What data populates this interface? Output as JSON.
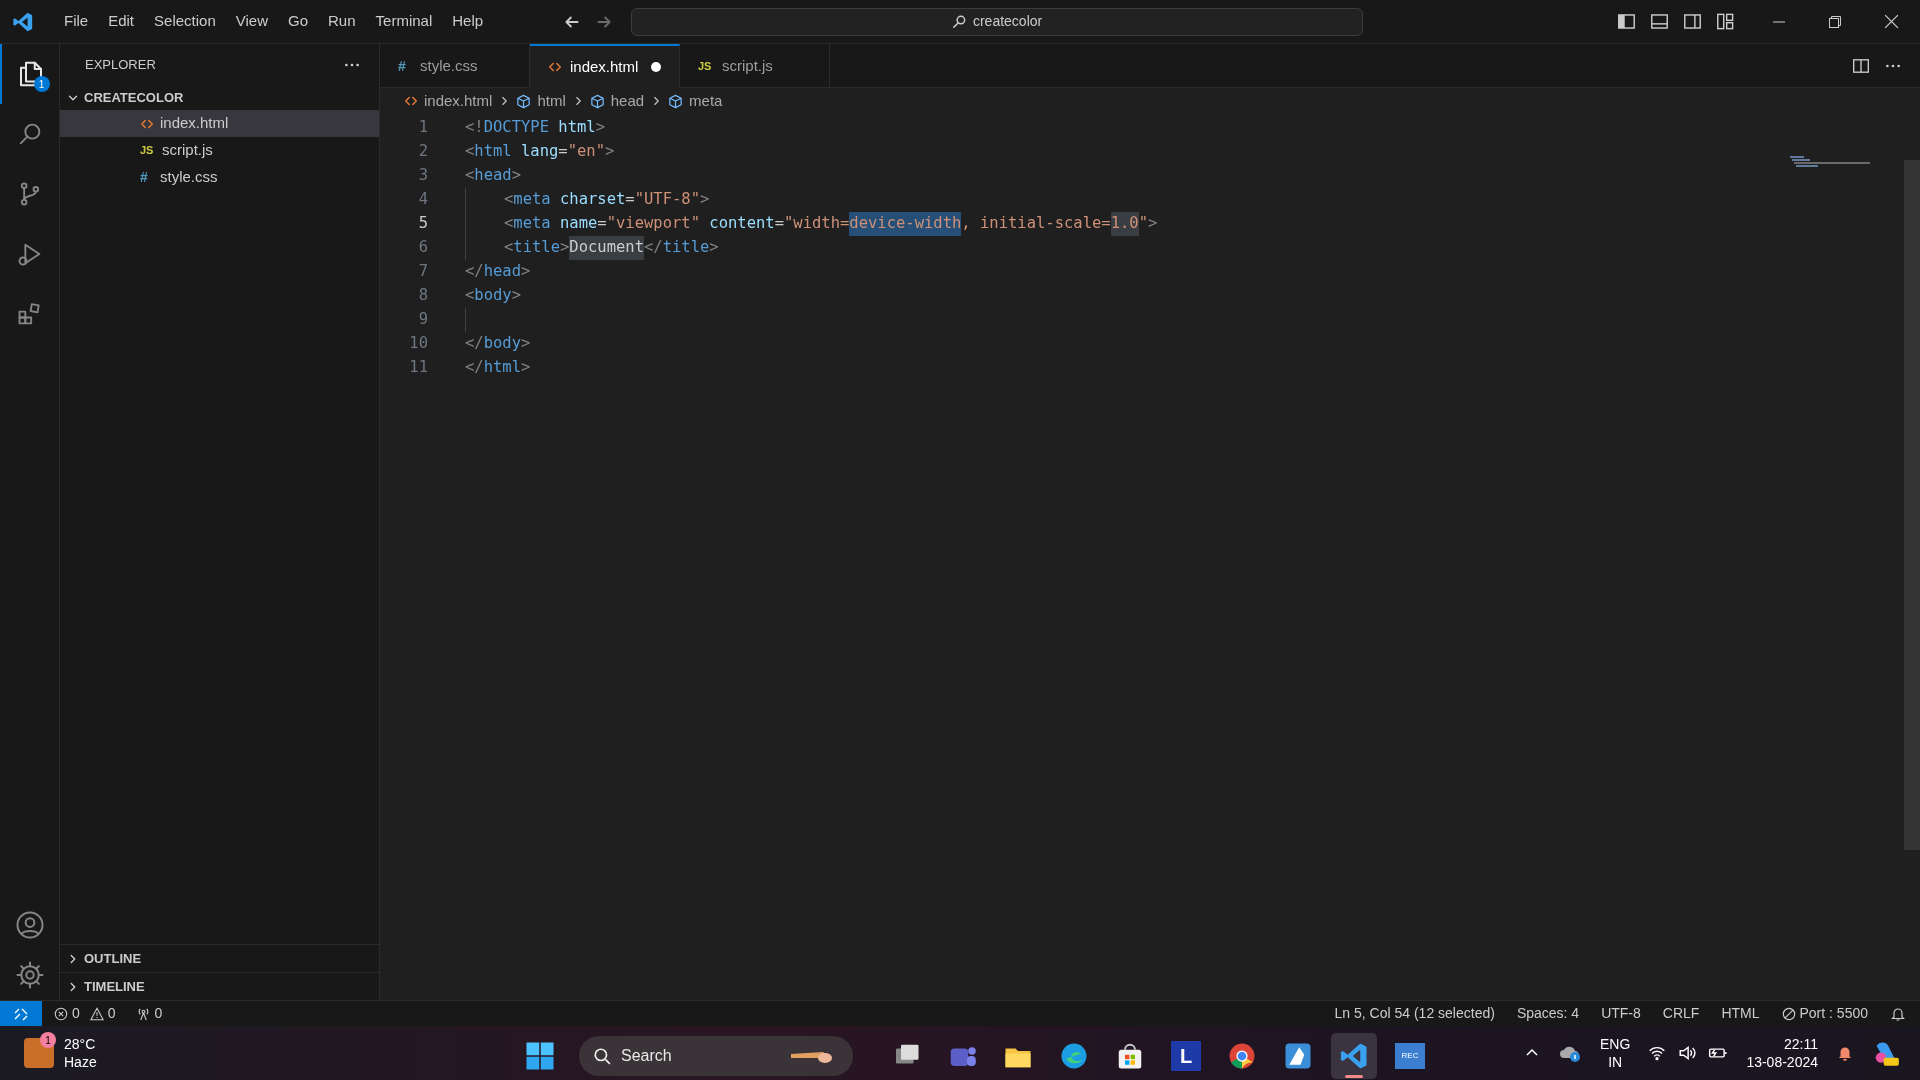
{
  "menu": [
    "File",
    "Edit",
    "Selection",
    "View",
    "Go",
    "Run",
    "Terminal",
    "Help"
  ],
  "command_center": {
    "value": "createcolor"
  },
  "activity_bar": {
    "items": [
      {
        "kind": "explorer",
        "selected": true,
        "badge": "1"
      },
      {
        "kind": "search",
        "selected": false
      },
      {
        "kind": "source-control",
        "selected": false
      },
      {
        "kind": "run",
        "selected": false
      },
      {
        "kind": "extensions",
        "selected": false
      }
    ],
    "bottom": [
      {
        "kind": "account"
      },
      {
        "kind": "settings"
      }
    ]
  },
  "sidebar": {
    "title": "EXPLORER",
    "folder": {
      "label": "CREATECOLOR",
      "expanded": true,
      "children": [
        {
          "label": "index.html",
          "kind": "html",
          "selected": true
        },
        {
          "label": "script.js",
          "kind": "js",
          "glyph": "JS",
          "selected": false
        },
        {
          "label": "style.css",
          "kind": "css",
          "glyph": "#",
          "selected": false
        }
      ]
    },
    "sections": [
      {
        "label": "OUTLINE",
        "expanded": false
      },
      {
        "label": "TIMELINE",
        "expanded": false
      }
    ]
  },
  "tabs": [
    {
      "label": "style.css",
      "kind": "css",
      "glyph": "#",
      "selected": false,
      "modified": false
    },
    {
      "label": "index.html",
      "kind": "html",
      "selected": true,
      "modified": true
    },
    {
      "label": "script.js",
      "kind": "js",
      "glyph": "JS",
      "selected": false,
      "modified": false
    }
  ],
  "breadcrumbs": [
    {
      "label": "index.html",
      "kind": "html"
    },
    {
      "label": "html",
      "kind": "symbol"
    },
    {
      "label": "head",
      "kind": "symbol"
    },
    {
      "label": "meta",
      "kind": "symbol"
    }
  ],
  "editor": {
    "lines": [
      {
        "number": "1",
        "active": false,
        "indented": false,
        "segments": [
          {
            "text": "<!DOCTYPE html>",
            "kind": "plain"
          }
        ]
      },
      {
        "number": "2",
        "active": false,
        "indented": false,
        "segments": [
          {
            "text": "<html lang=\"en\">",
            "kind": "plain"
          }
        ]
      },
      {
        "number": "3",
        "active": false,
        "indented": false,
        "segments": [
          {
            "text": "<head>",
            "kind": "plain"
          }
        ]
      },
      {
        "number": "4",
        "active": false,
        "indented": true,
        "segments": [
          {
            "text": "<meta charset=\"UTF-8\">",
            "kind": "plain"
          }
        ]
      },
      {
        "number": "5",
        "active": true,
        "indented": true,
        "segments": [
          {
            "text": "<meta name=\"viewport\" content=\"width=",
            "kind": "plain"
          },
          {
            "text": "device-width",
            "kind": "selection"
          },
          {
            "text": ", initial-scale=",
            "kind": "plain"
          },
          {
            "text": "1.0",
            "kind": "match"
          },
          {
            "text": "\">",
            "kind": "plain"
          }
        ]
      },
      {
        "number": "6",
        "active": false,
        "indented": true,
        "segments": [
          {
            "text": "<title>",
            "kind": "plain"
          },
          {
            "text": "Document",
            "kind": "match"
          },
          {
            "text": "</title>",
            "kind": "plain"
          }
        ]
      },
      {
        "number": "7",
        "active": false,
        "indented": false,
        "segments": [
          {
            "text": "</head>",
            "kind": "plain"
          }
        ]
      },
      {
        "number": "8",
        "active": false,
        "indented": false,
        "segments": [
          {
            "text": "<body>",
            "kind": "plain"
          }
        ]
      },
      {
        "number": "9",
        "active": false,
        "indented": true
      },
      {
        "number": "10",
        "active": false,
        "indented": false,
        "segments": [
          {
            "text": "</body>",
            "kind": "plain"
          }
        ]
      },
      {
        "number": "11",
        "active": false,
        "indented": false,
        "segments": [
          {
            "text": "</html>",
            "kind": "plain"
          }
        ]
      }
    ]
  },
  "status_bar": {
    "errors": "0",
    "warnings": "0",
    "ports": "0",
    "items": [
      "Ln 5, Col 54 (12 selected)",
      "Spaces: 4",
      "UTF-8",
      "CRLF",
      "HTML"
    ],
    "port": "Port : 5500"
  },
  "taskbar": {
    "weather": {
      "badge": "1",
      "temperature": "28°C",
      "condition": "Haze"
    },
    "search": {
      "placeholder": "Search"
    },
    "apps": [
      {
        "kind": "task-view",
        "active": false
      },
      {
        "kind": "teams",
        "active": false
      },
      {
        "kind": "folder",
        "active": false
      },
      {
        "kind": "edge",
        "active": false
      },
      {
        "kind": "store",
        "active": false
      },
      {
        "kind": "letter",
        "label": "L",
        "active": false
      },
      {
        "kind": "chrome",
        "active": false
      },
      {
        "kind": "paint",
        "active": false
      },
      {
        "kind": "vscode",
        "active": true
      },
      {
        "kind": "recorder",
        "label": "REC",
        "active": false
      }
    ],
    "language": {
      "primary": "ENG",
      "secondary": "IN"
    },
    "time": "22:11",
    "date": "13-08-2024"
  }
}
